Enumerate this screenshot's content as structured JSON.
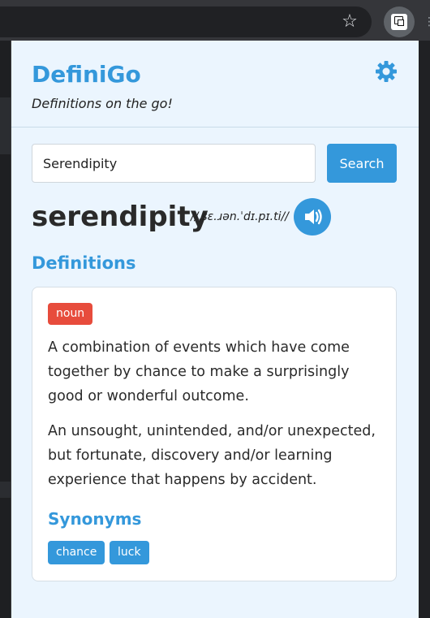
{
  "popup": {
    "brand": "DefiniGo",
    "tagline": "Definitions on the go!",
    "search": {
      "value": "Serendipity",
      "button_label": "Search"
    },
    "word": "serendipity",
    "phonetic": "//ˌsɛ.ɹən.ˈdɪ.pɪ.ti//",
    "definitions_heading": "Definitions",
    "part_of_speech": "noun",
    "definitions": [
      "A combination of events which have come together by chance to make a surprisingly good or wonderful outcome.",
      "An unsought, unintended, and/or unexpected, but fortunate, discovery and/or learning experience that happens by accident."
    ],
    "synonyms_heading": "Synonyms",
    "synonyms": [
      "chance",
      "luck"
    ]
  },
  "colors": {
    "accent": "#3498db",
    "badge_noun": "#e74c3c",
    "popup_bg": "#ebf5fe",
    "chrome_bg": "#35363a"
  },
  "icons": {
    "settings": "gear-icon",
    "audio": "speaker-icon",
    "bookmark": "star-icon",
    "extension": "definigo-extension-icon"
  }
}
